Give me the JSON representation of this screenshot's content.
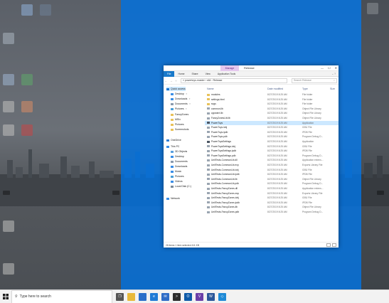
{
  "explorer": {
    "context_tab": "Manage",
    "title": "Release",
    "window_controls": {
      "minimize": "—",
      "maximize": "☐",
      "close": "✕"
    },
    "ribbon_tabs": [
      "File",
      "Home",
      "Share",
      "View",
      "Application Tools"
    ],
    "address": "« powertoys-master › x64 › Release",
    "search_placeholder": "Search Release",
    "nav_pane": [
      {
        "label": "Quick access",
        "icon": "star-icon",
        "color": "#1b75d0"
      },
      {
        "label": "Desktop",
        "icon": "folder-icon",
        "color": "#3a8ee6",
        "pinned": true
      },
      {
        "label": "Downloads",
        "icon": "download-icon",
        "color": "#3a8ee6",
        "pinned": true
      },
      {
        "label": "Documents",
        "icon": "folder-icon",
        "color": "#8a9aad",
        "pinned": true
      },
      {
        "label": "Pictures",
        "icon": "folder-icon",
        "color": "#4a9fd8",
        "pinned": true
      },
      {
        "label": "FanzyZones",
        "icon": "folder-icon",
        "color": "#e8c25a"
      },
      {
        "label": "MSIx",
        "icon": "folder-icon",
        "color": "#e8c25a"
      },
      {
        "label": "Pictures",
        "icon": "folder-icon",
        "color": "#e8c25a"
      },
      {
        "label": "Screenshots",
        "icon": "folder-icon",
        "color": "#e8c25a"
      },
      {
        "label": "OneDrive",
        "icon": "cloud-icon",
        "color": "#2e7fd6"
      },
      {
        "label": "This PC",
        "icon": "computer-icon",
        "color": "#3a8ee6"
      },
      {
        "label": "3D Objects",
        "icon": "folder-icon",
        "color": "#5aa0de"
      },
      {
        "label": "Desktop",
        "icon": "folder-icon",
        "color": "#3a8ee6"
      },
      {
        "label": "Documents",
        "icon": "folder-icon",
        "color": "#8a9aad"
      },
      {
        "label": "Downloads",
        "icon": "download-icon",
        "color": "#3a8ee6"
      },
      {
        "label": "Music",
        "icon": "music-icon",
        "color": "#3a8ee6"
      },
      {
        "label": "Pictures",
        "icon": "folder-icon",
        "color": "#4a9fd8"
      },
      {
        "label": "Videos",
        "icon": "video-icon",
        "color": "#3a8ee6"
      },
      {
        "label": "Local Disk (C:)",
        "icon": "drive-icon",
        "color": "#7a8a99"
      },
      {
        "label": "Network",
        "icon": "network-icon",
        "color": "#3a8ee6"
      }
    ],
    "columns": {
      "name": "Name",
      "date": "Date modified",
      "type": "Type",
      "size": "Size"
    },
    "files": [
      {
        "name": "modules",
        "date": "8/27/2019 8:25 AM",
        "type": "File folder",
        "color": "#e8c25a"
      },
      {
        "name": "settings-html",
        "date": "8/27/2019 8:25 AM",
        "type": "File folder",
        "color": "#e8c25a"
      },
      {
        "name": "svgs",
        "date": "8/27/2019 8:25 AM",
        "type": "File folder",
        "color": "#e8c25a"
      },
      {
        "name": "common.lib",
        "date": "8/27/2019 8:25 AM",
        "type": "Object File Library",
        "color": "#9aa5b1"
      },
      {
        "name": "cppwinrt.lib",
        "date": "8/27/2019 8:25 AM",
        "type": "Object File Library",
        "color": "#9aa5b1"
      },
      {
        "name": "FancyZonesLib.lib",
        "date": "8/27/2019 8:25 AM",
        "type": "Object File Library",
        "color": "#9aa5b1"
      },
      {
        "name": "PowerToys",
        "date": "8/27/2019 8:25 AM",
        "type": "Application",
        "color": "#4b5563",
        "selected": true
      },
      {
        "name": "PowerToys.iobj",
        "date": "8/27/2019 8:25 AM",
        "type": "IOBJ File",
        "color": "#9aa5b1"
      },
      {
        "name": "PowerToys.ipdb",
        "date": "8/27/2019 8:25 AM",
        "type": "IPDB File",
        "color": "#9aa5b1"
      },
      {
        "name": "PowerToys.pdb",
        "date": "8/27/2019 8:25 AM",
        "type": "Program Debug D...",
        "color": "#9aa5b1"
      },
      {
        "name": "PowerToysSettings",
        "date": "8/27/2019 8:25 AM",
        "type": "Application",
        "color": "#4b5563"
      },
      {
        "name": "PowerToysSettings.iobj",
        "date": "8/27/2019 8:25 AM",
        "type": "IOBJ File",
        "color": "#9aa5b1"
      },
      {
        "name": "PowerToysSettings.ipdb",
        "date": "8/27/2019 8:25 AM",
        "type": "IPDB File",
        "color": "#9aa5b1"
      },
      {
        "name": "PowerToysSettings.pdb",
        "date": "8/27/2019 8:25 AM",
        "type": "Program Debug D...",
        "color": "#9aa5b1"
      },
      {
        "name": "UnitTests-CommonLib.dll",
        "date": "8/27/2019 8:25 AM",
        "type": "Application extens...",
        "color": "#9aa5b1"
      },
      {
        "name": "UnitTests-CommonLib.exp",
        "date": "8/27/2019 8:25 AM",
        "type": "Exports Library File",
        "color": "#9aa5b1"
      },
      {
        "name": "UnitTests-CommonLib.iobj",
        "date": "8/27/2019 8:25 AM",
        "type": "IOBJ File",
        "color": "#9aa5b1"
      },
      {
        "name": "UnitTests-CommonLib.ipdb",
        "date": "8/27/2019 8:25 AM",
        "type": "IPDB File",
        "color": "#9aa5b1"
      },
      {
        "name": "UnitTests-CommonLib.lib",
        "date": "8/27/2019 8:25 AM",
        "type": "Object File Library",
        "color": "#9aa5b1"
      },
      {
        "name": "UnitTests-CommonLib.pdb",
        "date": "8/27/2019 8:25 AM",
        "type": "Program Debug D...",
        "color": "#9aa5b1"
      },
      {
        "name": "UnitTests-FancyZones.dll",
        "date": "8/27/2019 8:25 AM",
        "type": "Application extens...",
        "color": "#9aa5b1"
      },
      {
        "name": "UnitTests-FancyZones.exp",
        "date": "8/27/2019 8:25 AM",
        "type": "Exports Library File",
        "color": "#9aa5b1"
      },
      {
        "name": "UnitTests-FancyZones.iobj",
        "date": "8/27/2019 8:25 AM",
        "type": "IOBJ File",
        "color": "#9aa5b1"
      },
      {
        "name": "UnitTests-FancyZones.ipdb",
        "date": "8/27/2019 8:25 AM",
        "type": "IPDB File",
        "color": "#9aa5b1"
      },
      {
        "name": "UnitTests-FancyZones.lib",
        "date": "8/27/2019 8:25 AM",
        "type": "Object File Library",
        "color": "#9aa5b1"
      },
      {
        "name": "UnitTests-FancyZones.pdb",
        "date": "8/27/2019 8:25 AM",
        "type": "Program Debug D...",
        "color": "#9aa5b1"
      }
    ],
    "status": "26 items    1 item selected  411 KB"
  },
  "taskbar": {
    "search_placeholder": "Type here to search",
    "apps": [
      {
        "name": "task-view-icon",
        "color": "#555555",
        "glyph": "❐"
      },
      {
        "name": "file-explorer-icon",
        "color": "#e8b93a",
        "glyph": ""
      },
      {
        "name": "store-icon",
        "color": "#2b6fc9",
        "glyph": ""
      },
      {
        "name": "edge-icon",
        "color": "#1f7bd6",
        "glyph": "e"
      },
      {
        "name": "mail-icon",
        "color": "#2e6cc7",
        "glyph": "✉"
      },
      {
        "name": "terminal-icon",
        "color": "#2d2d2d",
        "glyph": ">"
      },
      {
        "name": "outlook-icon",
        "color": "#0e5aa8",
        "glyph": "O"
      },
      {
        "name": "visual-studio-icon",
        "color": "#6b3fa8",
        "glyph": "V"
      },
      {
        "name": "word-icon",
        "color": "#2b579a",
        "glyph": "W"
      },
      {
        "name": "vs-code-icon",
        "color": "#1f8ad6",
        "glyph": "◇"
      }
    ]
  }
}
